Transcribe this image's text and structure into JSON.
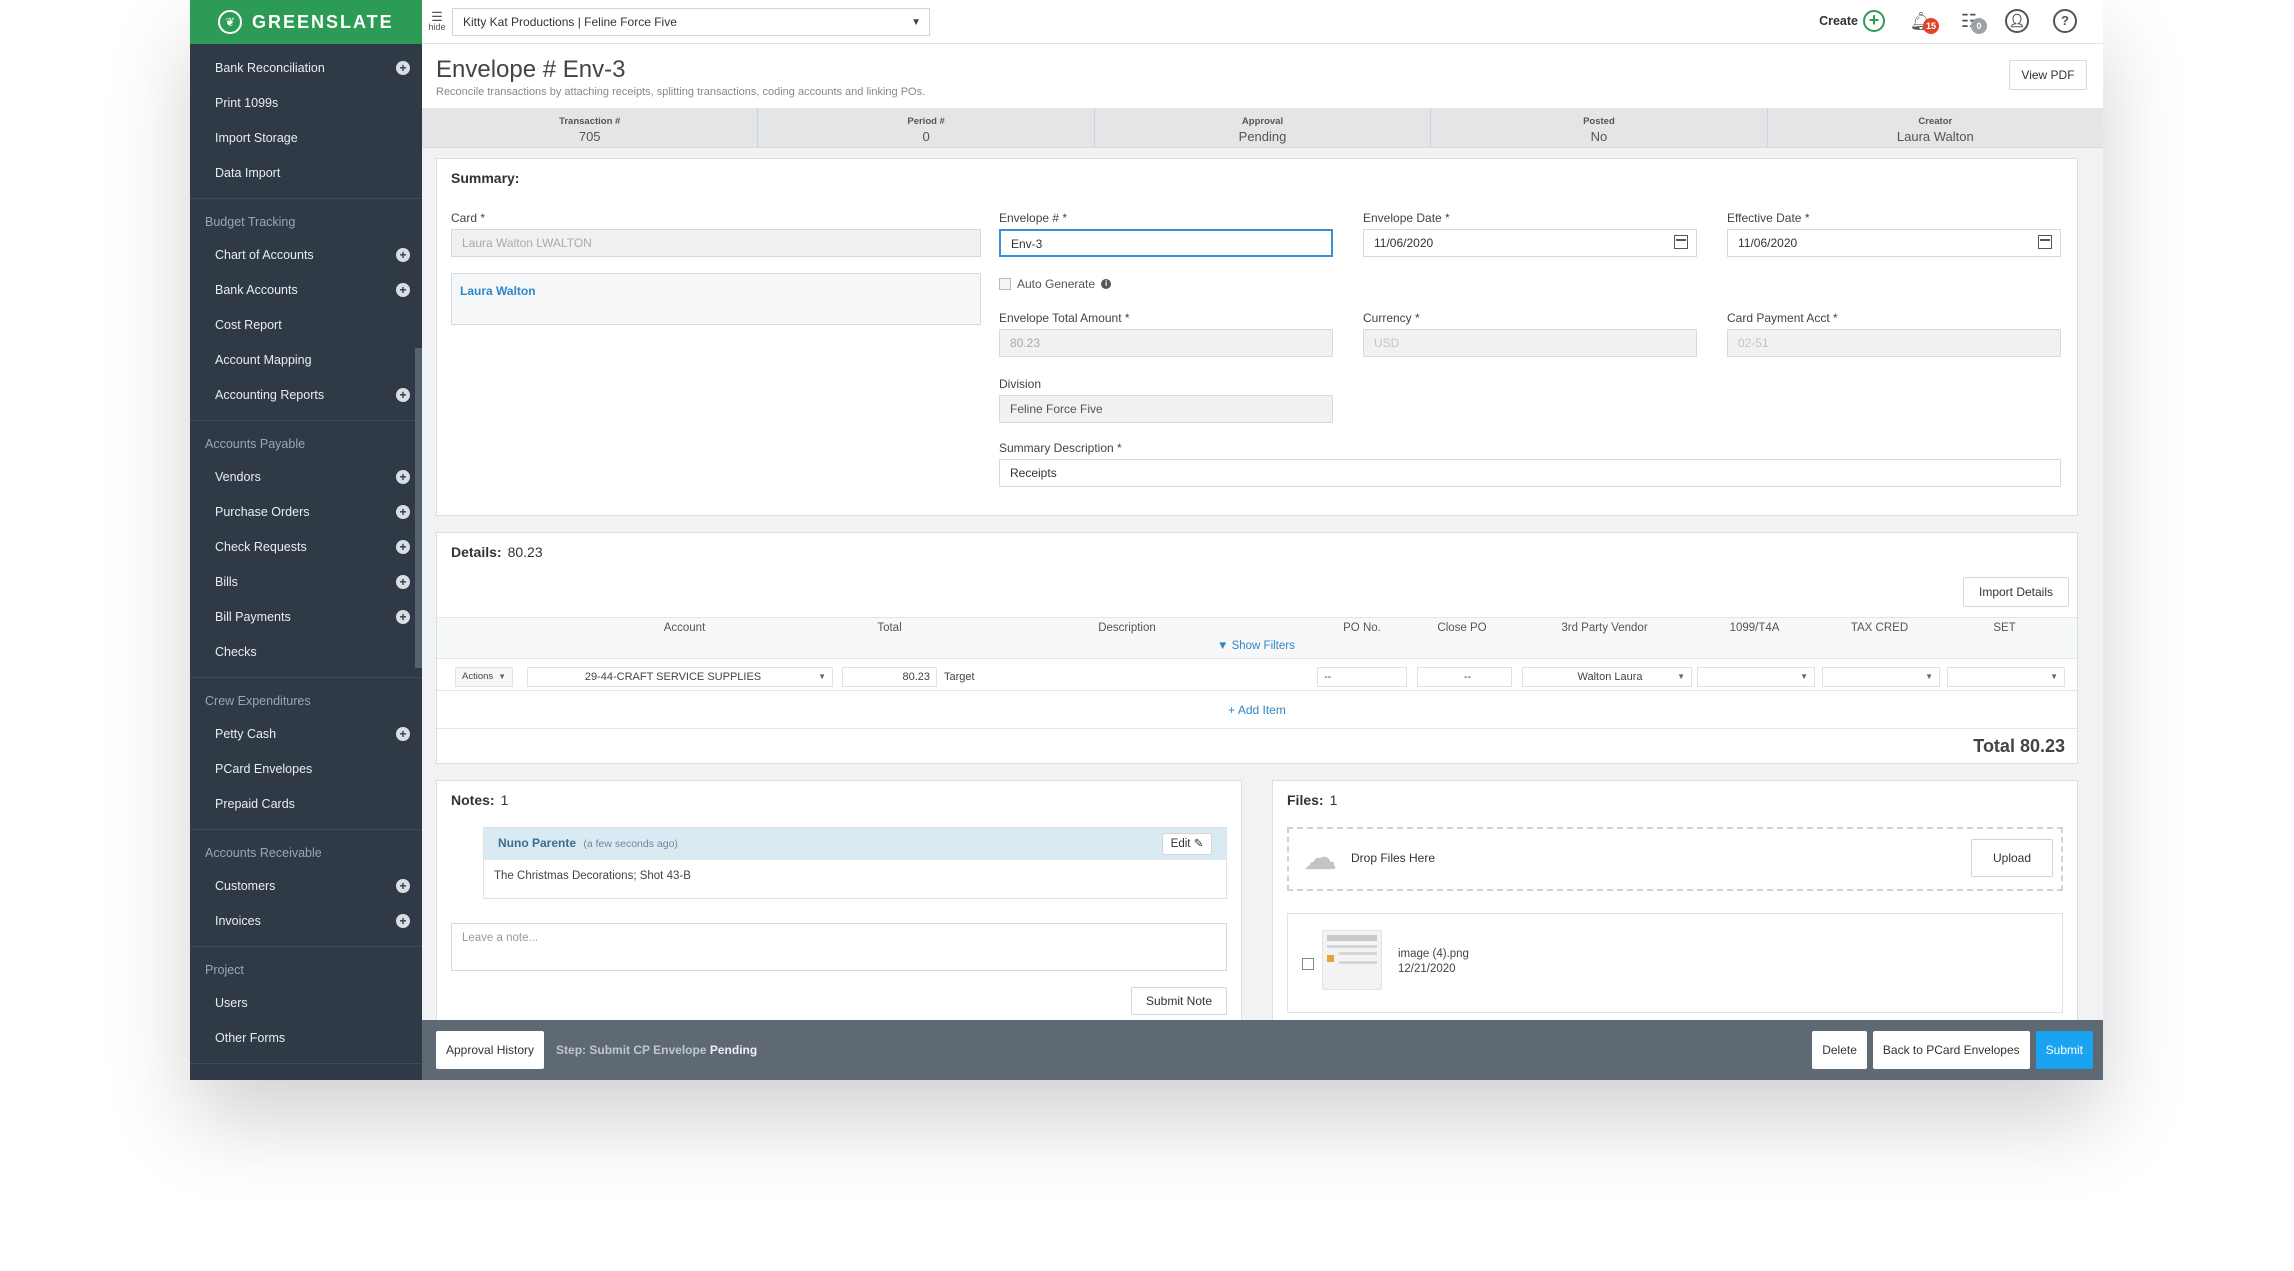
{
  "brand": {
    "name": "GREENSLATE"
  },
  "colors": {
    "brand": "#2c9b55",
    "sidebar": "#2f3a46",
    "accent": "#1aa3f0"
  },
  "sidebar": {
    "top_items": [
      {
        "label": "Bank Reconciliation",
        "plus": true
      },
      {
        "label": "Print 1099s",
        "plus": false
      },
      {
        "label": "Import Storage",
        "plus": false
      },
      {
        "label": "Data Import",
        "plus": false
      }
    ],
    "sections": [
      {
        "header": "Budget Tracking",
        "items": [
          {
            "label": "Chart of Accounts",
            "plus": true
          },
          {
            "label": "Bank Accounts",
            "plus": true
          },
          {
            "label": "Cost Report",
            "plus": false
          },
          {
            "label": "Account Mapping",
            "plus": false
          },
          {
            "label": "Accounting Reports",
            "plus": true
          }
        ]
      },
      {
        "header": "Accounts Payable",
        "items": [
          {
            "label": "Vendors",
            "plus": true
          },
          {
            "label": "Purchase Orders",
            "plus": true
          },
          {
            "label": "Check Requests",
            "plus": true
          },
          {
            "label": "Bills",
            "plus": true
          },
          {
            "label": "Bill Payments",
            "plus": true
          },
          {
            "label": "Checks",
            "plus": false
          }
        ]
      },
      {
        "header": "Crew Expenditures",
        "items": [
          {
            "label": "Petty Cash",
            "plus": true
          },
          {
            "label": "PCard Envelopes",
            "plus": false
          },
          {
            "label": "Prepaid Cards",
            "plus": false
          }
        ]
      },
      {
        "header": "Accounts Receivable",
        "items": [
          {
            "label": "Customers",
            "plus": true
          },
          {
            "label": "Invoices",
            "plus": true
          }
        ]
      },
      {
        "header": "Project",
        "items": [
          {
            "label": "Users",
            "plus": false
          },
          {
            "label": "Other Forms",
            "plus": false
          }
        ]
      }
    ]
  },
  "topbar": {
    "hide_label": "hide",
    "production": "Kitty Kat Productions | Feline Force Five",
    "create_label": "Create",
    "notifications_count": "15",
    "tasks_count": "0"
  },
  "page": {
    "title": "Envelope # Env-3",
    "subtitle": "Reconcile transactions by attaching receipts, splitting transactions, coding accounts and linking POs.",
    "view_pdf": "View PDF"
  },
  "meta": [
    {
      "label": "Transaction #",
      "value": "705"
    },
    {
      "label": "Period #",
      "value": "0"
    },
    {
      "label": "Approval",
      "value": "Pending"
    },
    {
      "label": "Posted",
      "value": "No"
    },
    {
      "label": "Creator",
      "value": "Laura Walton"
    }
  ],
  "summary": {
    "header": "Summary:",
    "card_label": "Card *",
    "card_value": "Laura Walton LWALTON",
    "cardholder": "Laura Walton",
    "envelope_no_label": "Envelope # *",
    "envelope_no": "Env-3",
    "envelope_date_label": "Envelope Date *",
    "envelope_date": "11/06/2020",
    "effective_date_label": "Effective Date *",
    "effective_date": "11/06/2020",
    "auto_generate": "Auto Generate",
    "total_amount_label": "Envelope Total Amount *",
    "total_amount": "80.23",
    "currency_label": "Currency *",
    "currency": "USD",
    "card_payment_label": "Card Payment Acct *",
    "card_payment": "02-51",
    "division_label": "Division",
    "division": "Feline Force Five",
    "description_label": "Summary Description *",
    "description": "Receipts"
  },
  "details": {
    "header": "Details:",
    "amount": "80.23",
    "import_button": "Import Details",
    "columns": [
      "Account",
      "Total",
      "Description",
      "PO No.",
      "Close PO",
      "3rd Party Vendor",
      "1099/T4A",
      "TAX CRED",
      "SET"
    ],
    "show_filters": "Show Filters",
    "row": {
      "actions": "Actions",
      "account": "29-44-CRAFT SERVICE SUPPLIES",
      "total": "80.23",
      "description": "Target",
      "po": "--",
      "close_po": "--",
      "vendor": "Walton Laura"
    },
    "add_item": "Add Item",
    "total_label": "Total 80.23"
  },
  "notes": {
    "header": "Notes:",
    "count": "1",
    "author": "Nuno Parente",
    "time": "(a few seconds ago)",
    "edit": "Edit",
    "text": "The Christmas Decorations; Shot 43-B",
    "placeholder": "Leave a note...",
    "submit": "Submit Note"
  },
  "files": {
    "header": "Files:",
    "count": "1",
    "drop": "Drop Files Here",
    "upload": "Upload",
    "file_name": "image (4).png",
    "file_date": "12/21/2020"
  },
  "footer": {
    "approval_history": "Approval History",
    "step_prefix": "Step:",
    "step_name": "Submit CP Envelope",
    "step_status": "Pending",
    "delete": "Delete",
    "back": "Back to PCard Envelopes",
    "submit": "Submit"
  }
}
